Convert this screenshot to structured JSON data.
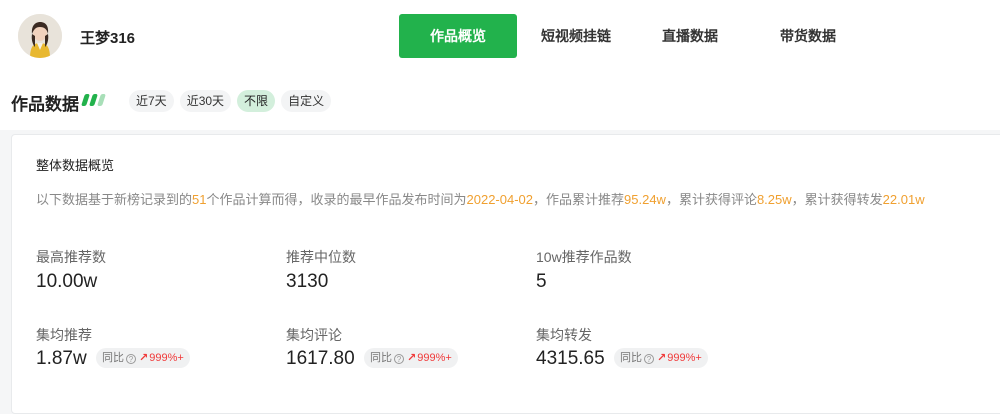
{
  "user": {
    "name": "王梦316",
    "avatar_icon": "user-avatar"
  },
  "tabs": [
    {
      "label": "作品概览",
      "active": true
    },
    {
      "label": "短视频挂链",
      "active": false
    },
    {
      "label": "直播数据",
      "active": false
    },
    {
      "label": "带货数据",
      "active": false
    }
  ],
  "section": {
    "title": "作品数据",
    "ranges": [
      {
        "label": "近7天",
        "selected": false
      },
      {
        "label": "近30天",
        "selected": false
      },
      {
        "label": "不限",
        "selected": true
      },
      {
        "label": "自定义",
        "selected": false
      }
    ]
  },
  "overview": {
    "title": "整体数据概览",
    "summary": {
      "p1": "以下数据基于新榜记录到的",
      "works_count": "51",
      "p2": "个作品计算而得，收录的最早作品发布时间为",
      "earliest_date": "2022-04-02",
      "p3": "，作品累计推荐",
      "total_recommend": "95.24w",
      "p4": "，累计获得评论",
      "total_comments": "8.25w",
      "p5": "，累计获得转发",
      "total_shares": "22.01w"
    },
    "stats_row1": [
      {
        "label": "最高推荐数",
        "value": "10.00w"
      },
      {
        "label": "推荐中位数",
        "value": "3130"
      },
      {
        "label": "10w推荐作品数",
        "value": "5"
      }
    ],
    "stats_row2": [
      {
        "label": "集均推荐",
        "value": "1.87w",
        "compare_label": "同比",
        "change": "999%+"
      },
      {
        "label": "集均评论",
        "value": "1617.80",
        "compare_label": "同比",
        "change": "999%+"
      },
      {
        "label": "集均转发",
        "value": "4315.65",
        "compare_label": "同比",
        "change": "999%+"
      }
    ]
  },
  "colors": {
    "accent": "#22b24c",
    "highlight": "#f0a030",
    "up": "#f03a3a"
  }
}
